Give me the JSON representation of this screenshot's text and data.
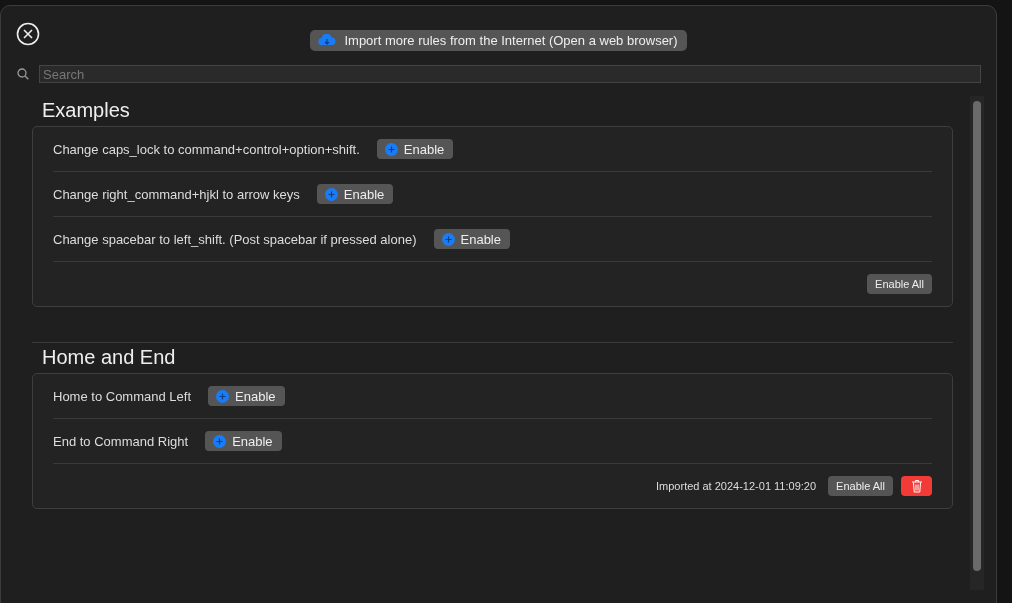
{
  "import_button": {
    "label": "Import more rules from the Internet (Open a web browser)"
  },
  "search": {
    "placeholder": "Search"
  },
  "sections": [
    {
      "title": "Examples",
      "rules": [
        {
          "label": "Change caps_lock to command+control+option+shift.",
          "button": "Enable"
        },
        {
          "label": "Change right_command+hjkl to arrow keys",
          "button": "Enable"
        },
        {
          "label": "Change spacebar to left_shift. (Post spacebar if pressed alone)",
          "button": "Enable"
        }
      ],
      "enable_all": "Enable All"
    },
    {
      "title": "Home and End",
      "rules": [
        {
          "label": "Home to Command Left",
          "button": "Enable"
        },
        {
          "label": "End to Command Right",
          "button": "Enable"
        }
      ],
      "imported": "Imported at 2024-12-01 11:09:20",
      "enable_all": "Enable All",
      "deletable": true
    }
  ]
}
